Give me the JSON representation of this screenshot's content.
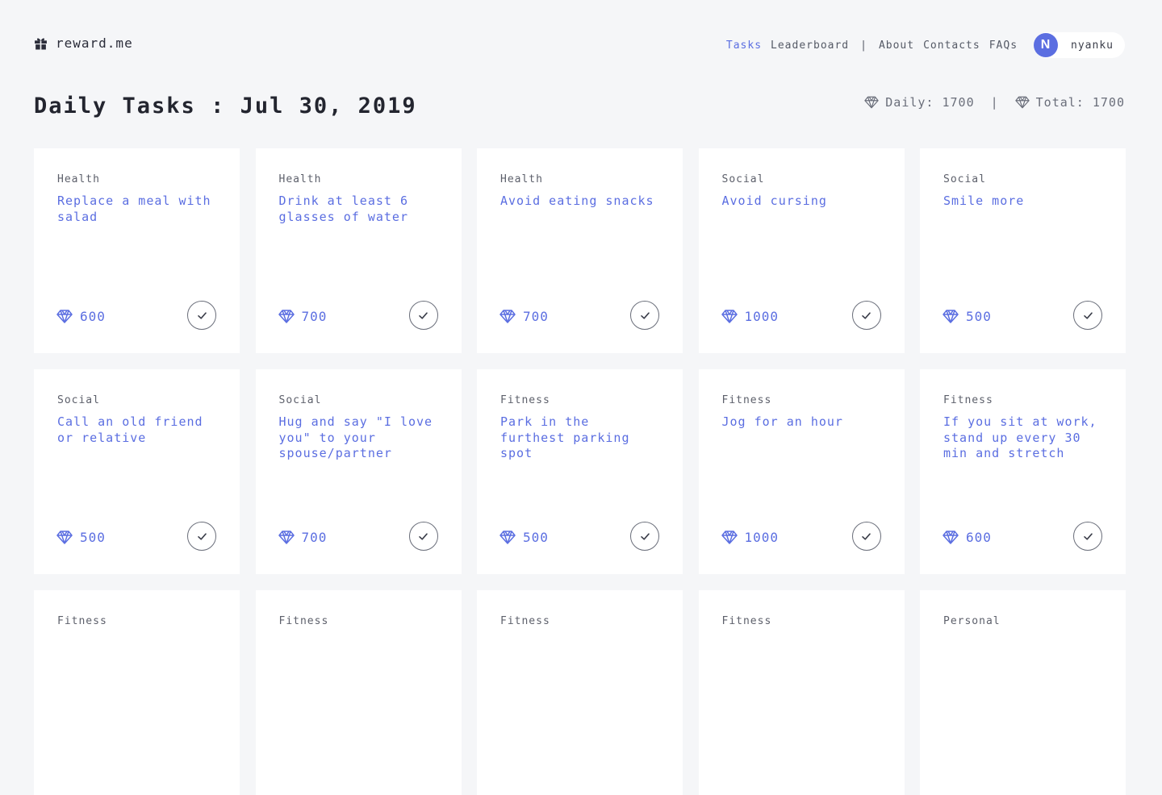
{
  "brand": {
    "name": "reward.me",
    "icon": "gift-icon"
  },
  "nav": {
    "items": [
      "Tasks",
      "Leaderboard",
      "About",
      "Contacts",
      "FAQs"
    ],
    "active": "Tasks",
    "separator": "|"
  },
  "user": {
    "initial": "N",
    "name": "nyanku"
  },
  "page": {
    "title": "Daily Tasks : Jul 30, 2019"
  },
  "totals": {
    "daily": "Daily: 1700",
    "divider": "|",
    "total": "Total: 1700"
  },
  "colors": {
    "accent": "#5b6ee1",
    "background": "#f5f6f8",
    "card": "#ffffff"
  },
  "tasks": [
    {
      "category": "Health",
      "title": "Replace a meal with salad",
      "points": "600"
    },
    {
      "category": "Health",
      "title": "Drink at least 6 glasses of water",
      "points": "700"
    },
    {
      "category": "Health",
      "title": "Avoid eating snacks",
      "points": "700"
    },
    {
      "category": "Social",
      "title": "Avoid cursing",
      "points": "1000"
    },
    {
      "category": "Social",
      "title": "Smile more",
      "points": "500"
    },
    {
      "category": "Social",
      "title": "Call an old friend or relative",
      "points": "500"
    },
    {
      "category": "Social",
      "title": "Hug and say \"I love you\" to your spouse/partner",
      "points": "700"
    },
    {
      "category": "Fitness",
      "title": "Park in the furthest parking spot",
      "points": "500"
    },
    {
      "category": "Fitness",
      "title": "Jog for an hour",
      "points": "1000"
    },
    {
      "category": "Fitness",
      "title": "If you sit at work, stand up every 30 min and stretch",
      "points": "600"
    },
    {
      "category": "Fitness"
    },
    {
      "category": "Fitness"
    },
    {
      "category": "Fitness"
    },
    {
      "category": "Fitness"
    },
    {
      "category": "Personal"
    }
  ]
}
